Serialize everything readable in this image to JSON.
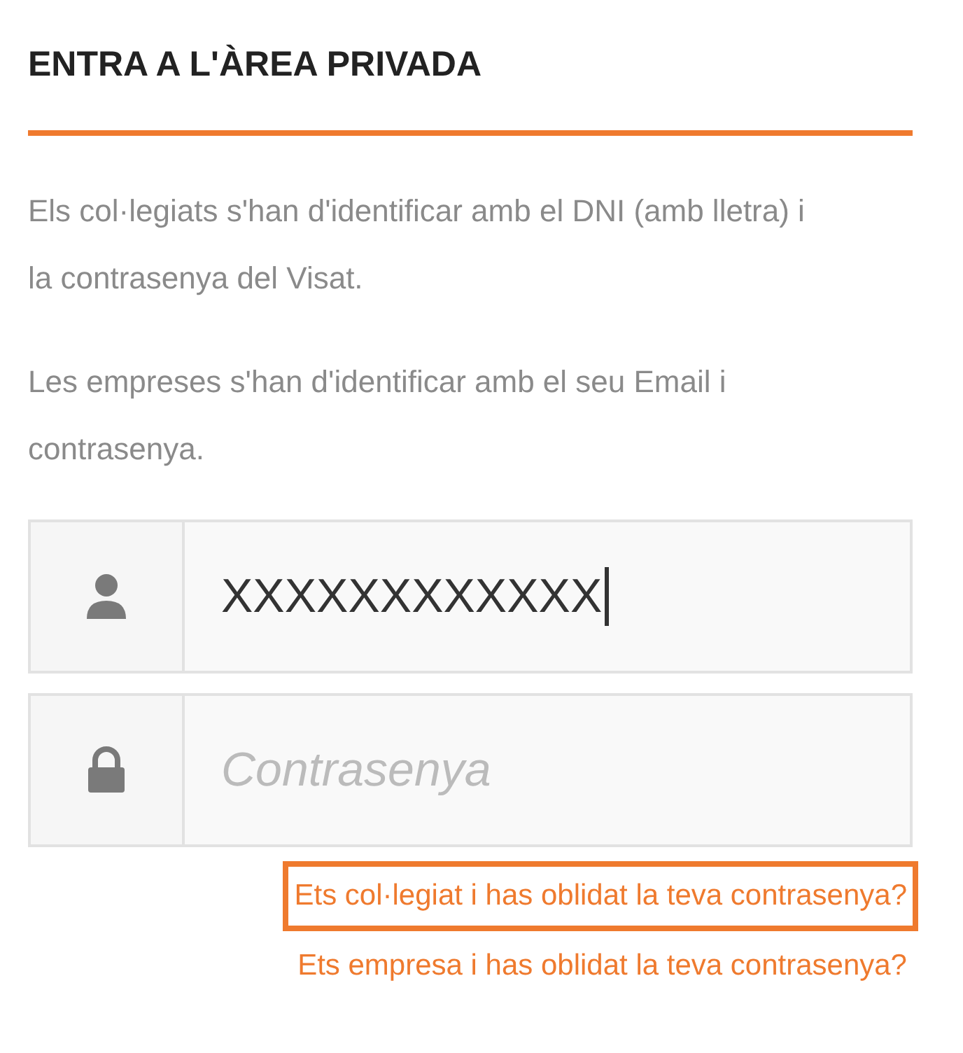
{
  "heading": "ENTRA A L'ÀREA PRIVADA",
  "paragraphs": [
    "Els col·legiats s'han d'identificar amb el DNI (amb lletra) i la contrasenya del Visat.",
    "Les empreses s'han d'identificar amb el seu Email i contrasenya."
  ],
  "fields": [
    {
      "kind": "user",
      "value": "XXXXXXXXXXXX",
      "focused": true
    },
    {
      "kind": "password",
      "placeholder": "Contrasenya",
      "focused": false
    }
  ],
  "links": [
    {
      "label": "Ets col·legiat i has oblidat la teva contrasenya?",
      "highlighted": true
    },
    {
      "label": "Ets empresa i has oblidat la teva contrasenya?",
      "highlighted": false
    }
  ]
}
